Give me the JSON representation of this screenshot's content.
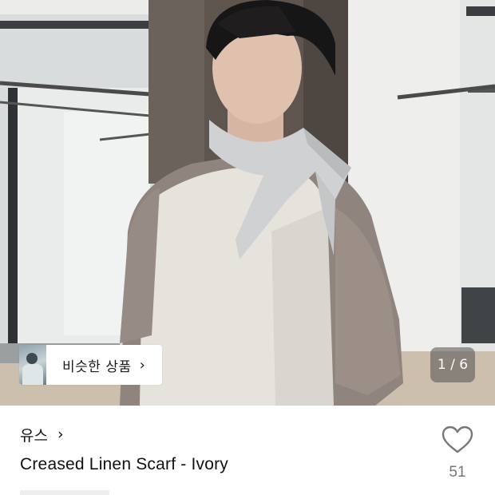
{
  "photo": {
    "alt": "Creased Linen Scarf - Ivory",
    "similar_button": {
      "label": "비슷한 상품",
      "chevron": "›",
      "thumb_icon": "similar-product-thumbnail"
    },
    "counter": "1 / 6"
  },
  "product": {
    "brand": "유스",
    "brand_chevron": "›",
    "title": "Creased Linen Scarf - Ivory",
    "like_icon": "heart-outline-icon",
    "like_count": "51"
  },
  "colors": {
    "text": "#111111",
    "muted": "#777777",
    "counter_bg": "#505050"
  }
}
